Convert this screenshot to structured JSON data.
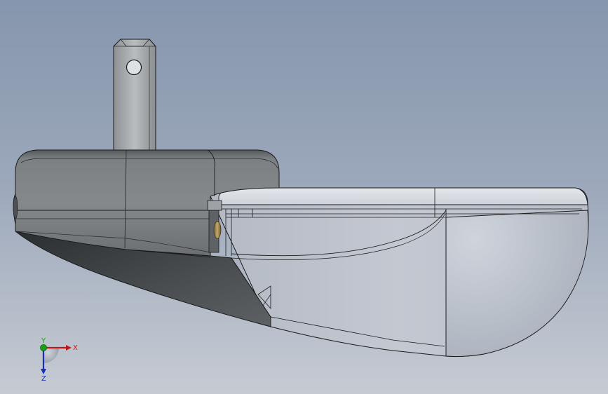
{
  "viewport": {
    "background_top": "#8696ad",
    "background_bottom": "#c6cbd3"
  },
  "model": {
    "body_color": "#707477",
    "transparent_color": "#d5d9e0",
    "edge_color": "#1a1a1a"
  },
  "triad": {
    "x_label": "X",
    "y_label": "Y",
    "z_label": "Z",
    "x_color": "#c01818",
    "y_color": "#18a018",
    "z_color": "#1a2fb0"
  }
}
